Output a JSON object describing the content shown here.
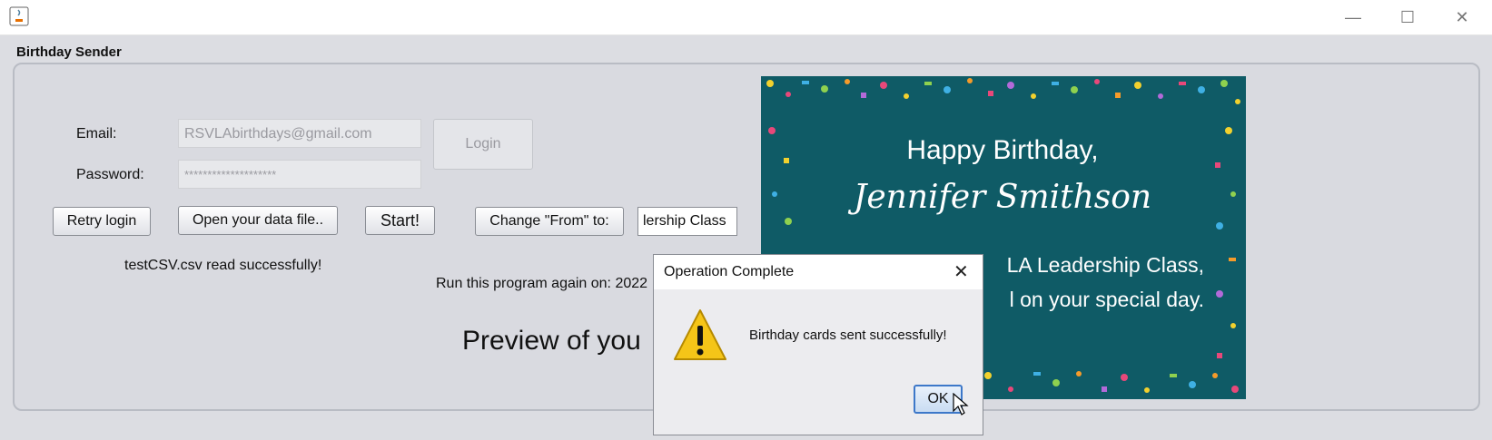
{
  "window": {
    "close_glyph": "✕",
    "minimize_glyph": "—",
    "maximize_glyph": "☐"
  },
  "frame": {
    "title": "Birthday Sender"
  },
  "form": {
    "email_label": "Email:",
    "email_value": "RSVLAbirthdays@gmail.com",
    "password_label": "Password:",
    "password_value": "********************",
    "login_label": "Login",
    "retry_label": "Retry login",
    "open_file_label": "Open your data file..",
    "start_label": "Start!",
    "change_from_label": "Change \"From\" to:",
    "from_value": "lership Class",
    "status_text": "testCSV.csv read successfully!",
    "run_again_text": "Run this program again on: 2022",
    "preview_text": "Preview of you"
  },
  "card": {
    "line1": "Happy Birthday,",
    "line2": "Jennifer Smithson",
    "line3": "LA Leadership Class,",
    "line4": "l on your special day."
  },
  "dialog": {
    "title": "Operation Complete",
    "close_glyph": "✕",
    "message": "Birthday cards sent successfully!",
    "ok_label": "OK",
    "icon": "warning-icon"
  },
  "colors": {
    "card_bg": "#0f5b66",
    "dialog_ok_border": "#3d78c9",
    "warning_yellow": "#f5c518"
  }
}
